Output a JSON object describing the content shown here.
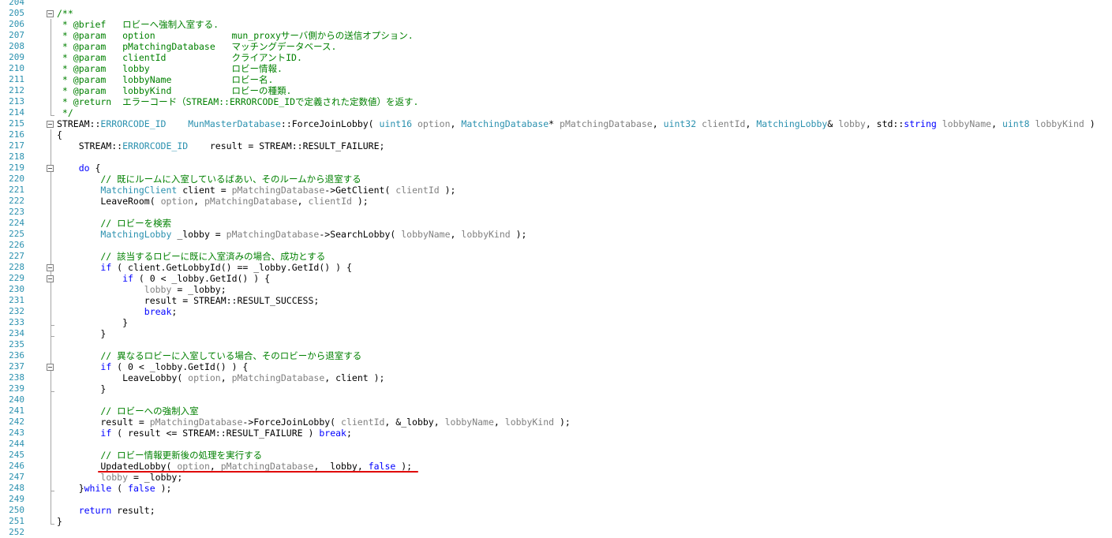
{
  "lines": [
    {
      "n": "204",
      "code": []
    },
    {
      "n": "205",
      "code": [
        {
          "t": "/**",
          "c": "c"
        }
      ]
    },
    {
      "n": "206",
      "code": [
        {
          "t": " * @brief   ロビーへ強制入室する.",
          "c": "c"
        }
      ]
    },
    {
      "n": "207",
      "code": [
        {
          "t": " * @param   option              mun_proxyサーバ側からの送信オプション.",
          "c": "c"
        }
      ]
    },
    {
      "n": "208",
      "code": [
        {
          "t": " * @param   pMatchingDatabase   マッチングデータベース.",
          "c": "c"
        }
      ]
    },
    {
      "n": "209",
      "code": [
        {
          "t": " * @param   clientId            クライアントID.",
          "c": "c"
        }
      ]
    },
    {
      "n": "210",
      "code": [
        {
          "t": " * @param   lobby               ロビー情報.",
          "c": "c"
        }
      ]
    },
    {
      "n": "211",
      "code": [
        {
          "t": " * @param   lobbyName           ロビー名.",
          "c": "c"
        }
      ]
    },
    {
      "n": "212",
      "code": [
        {
          "t": " * @param   lobbyKind           ロビーの種類.",
          "c": "c"
        }
      ]
    },
    {
      "n": "213",
      "code": [
        {
          "t": " * @return  エラーコード（STREAM::ERRORCODE_IDで定義された定数値）を返す.",
          "c": "c"
        }
      ]
    },
    {
      "n": "214",
      "code": [
        {
          "t": " */",
          "c": "c"
        }
      ]
    },
    {
      "n": "215",
      "code": [
        {
          "t": "STREAM::",
          "c": ""
        },
        {
          "t": "ERRORCODE_ID",
          "c": "t"
        },
        {
          "t": "    ",
          "c": ""
        },
        {
          "t": "MunMasterDatabase",
          "c": "t"
        },
        {
          "t": "::ForceJoinLobby( ",
          "c": ""
        },
        {
          "t": "uint16",
          "c": "t"
        },
        {
          "t": " option",
          "c": "p"
        },
        {
          "t": ", ",
          "c": ""
        },
        {
          "t": "MatchingDatabase",
          "c": "t"
        },
        {
          "t": "* ",
          "c": ""
        },
        {
          "t": "pMatchingDatabase",
          "c": "p"
        },
        {
          "t": ", ",
          "c": ""
        },
        {
          "t": "uint32",
          "c": "t"
        },
        {
          "t": " clientId",
          "c": "p"
        },
        {
          "t": ", ",
          "c": ""
        },
        {
          "t": "MatchingLobby",
          "c": "t"
        },
        {
          "t": "& ",
          "c": ""
        },
        {
          "t": "lobby",
          "c": "p"
        },
        {
          "t": ", std::",
          "c": ""
        },
        {
          "t": "string",
          "c": "k"
        },
        {
          "t": " lobbyName",
          "c": "p"
        },
        {
          "t": ", ",
          "c": ""
        },
        {
          "t": "uint8",
          "c": "t"
        },
        {
          "t": " lobbyKind",
          "c": "p"
        },
        {
          "t": " )",
          "c": ""
        }
      ]
    },
    {
      "n": "216",
      "code": [
        {
          "t": "{",
          "c": ""
        }
      ]
    },
    {
      "n": "217",
      "code": [
        {
          "t": "    STREAM::",
          "c": ""
        },
        {
          "t": "ERRORCODE_ID",
          "c": "t"
        },
        {
          "t": "    result = STREAM::RESULT_FAILURE;",
          "c": ""
        }
      ]
    },
    {
      "n": "218",
      "code": []
    },
    {
      "n": "219",
      "code": [
        {
          "t": "    ",
          "c": ""
        },
        {
          "t": "do",
          "c": "k"
        },
        {
          "t": " {",
          "c": ""
        }
      ]
    },
    {
      "n": "220",
      "code": [
        {
          "t": "        // 既にルームに入室しているばあい、そのルームから退室する",
          "c": "c"
        }
      ]
    },
    {
      "n": "221",
      "code": [
        {
          "t": "        ",
          "c": ""
        },
        {
          "t": "MatchingClient",
          "c": "t"
        },
        {
          "t": " client = ",
          "c": ""
        },
        {
          "t": "pMatchingDatabase",
          "c": "p"
        },
        {
          "t": "->GetClient( ",
          "c": ""
        },
        {
          "t": "clientId",
          "c": "p"
        },
        {
          "t": " );",
          "c": ""
        }
      ]
    },
    {
      "n": "222",
      "code": [
        {
          "t": "        LeaveRoom( ",
          "c": ""
        },
        {
          "t": "option",
          "c": "p"
        },
        {
          "t": ", ",
          "c": ""
        },
        {
          "t": "pMatchingDatabase",
          "c": "p"
        },
        {
          "t": ", ",
          "c": ""
        },
        {
          "t": "clientId",
          "c": "p"
        },
        {
          "t": " );",
          "c": ""
        }
      ]
    },
    {
      "n": "223",
      "code": []
    },
    {
      "n": "224",
      "code": [
        {
          "t": "        // ロビーを検索",
          "c": "c"
        }
      ]
    },
    {
      "n": "225",
      "code": [
        {
          "t": "        ",
          "c": ""
        },
        {
          "t": "MatchingLobby",
          "c": "t"
        },
        {
          "t": " _lobby = ",
          "c": ""
        },
        {
          "t": "pMatchingDatabase",
          "c": "p"
        },
        {
          "t": "->SearchLobby( ",
          "c": ""
        },
        {
          "t": "lobbyName",
          "c": "p"
        },
        {
          "t": ", ",
          "c": ""
        },
        {
          "t": "lobbyKind",
          "c": "p"
        },
        {
          "t": " );",
          "c": ""
        }
      ]
    },
    {
      "n": "226",
      "code": []
    },
    {
      "n": "227",
      "code": [
        {
          "t": "        // 該当するロビーに既に入室済みの場合、成功とする",
          "c": "c"
        }
      ]
    },
    {
      "n": "228",
      "code": [
        {
          "t": "        ",
          "c": ""
        },
        {
          "t": "if",
          "c": "k"
        },
        {
          "t": " ( client.GetLobbyId() == _lobby.GetId() ) {",
          "c": ""
        }
      ]
    },
    {
      "n": "229",
      "code": [
        {
          "t": "            ",
          "c": ""
        },
        {
          "t": "if",
          "c": "k"
        },
        {
          "t": " ( 0 < _lobby.GetId() ) {",
          "c": ""
        }
      ]
    },
    {
      "n": "230",
      "code": [
        {
          "t": "                ",
          "c": ""
        },
        {
          "t": "lobby",
          "c": "p"
        },
        {
          "t": " = _lobby;",
          "c": ""
        }
      ]
    },
    {
      "n": "231",
      "code": [
        {
          "t": "                result = STREAM::RESULT_SUCCESS;",
          "c": ""
        }
      ]
    },
    {
      "n": "232",
      "code": [
        {
          "t": "                ",
          "c": ""
        },
        {
          "t": "break",
          "c": "k"
        },
        {
          "t": ";",
          "c": ""
        }
      ]
    },
    {
      "n": "233",
      "code": [
        {
          "t": "            }",
          "c": ""
        }
      ]
    },
    {
      "n": "234",
      "code": [
        {
          "t": "        }",
          "c": ""
        }
      ]
    },
    {
      "n": "235",
      "code": []
    },
    {
      "n": "236",
      "code": [
        {
          "t": "        // 異なるロビーに入室している場合、そのロビーから退室する",
          "c": "c"
        }
      ]
    },
    {
      "n": "237",
      "code": [
        {
          "t": "        ",
          "c": ""
        },
        {
          "t": "if",
          "c": "k"
        },
        {
          "t": " ( 0 < _lobby.GetId() ) {",
          "c": ""
        }
      ]
    },
    {
      "n": "238",
      "code": [
        {
          "t": "            LeaveLobby( ",
          "c": ""
        },
        {
          "t": "option",
          "c": "p"
        },
        {
          "t": ", ",
          "c": ""
        },
        {
          "t": "pMatchingDatabase",
          "c": "p"
        },
        {
          "t": ", client );",
          "c": ""
        }
      ]
    },
    {
      "n": "239",
      "code": [
        {
          "t": "        }",
          "c": ""
        }
      ]
    },
    {
      "n": "240",
      "code": []
    },
    {
      "n": "241",
      "code": [
        {
          "t": "        // ロビーへの強制入室",
          "c": "c"
        }
      ]
    },
    {
      "n": "242",
      "code": [
        {
          "t": "        result = ",
          "c": ""
        },
        {
          "t": "pMatchingDatabase",
          "c": "p"
        },
        {
          "t": "->ForceJoinLobby( ",
          "c": ""
        },
        {
          "t": "clientId",
          "c": "p"
        },
        {
          "t": ", &_lobby, ",
          "c": ""
        },
        {
          "t": "lobbyName",
          "c": "p"
        },
        {
          "t": ", ",
          "c": ""
        },
        {
          "t": "lobbyKind",
          "c": "p"
        },
        {
          "t": " );",
          "c": ""
        }
      ]
    },
    {
      "n": "243",
      "code": [
        {
          "t": "        ",
          "c": ""
        },
        {
          "t": "if",
          "c": "k"
        },
        {
          "t": " ( result <= STREAM::RESULT_FAILURE ) ",
          "c": ""
        },
        {
          "t": "break",
          "c": "k"
        },
        {
          "t": ";",
          "c": ""
        }
      ]
    },
    {
      "n": "244",
      "code": []
    },
    {
      "n": "245",
      "code": [
        {
          "t": "        // ロビー情報更新後の処理を実行する",
          "c": "c"
        }
      ]
    },
    {
      "n": "246",
      "code": [
        {
          "t": "        UpdatedLobby( ",
          "c": ""
        },
        {
          "t": "option",
          "c": "p"
        },
        {
          "t": ", ",
          "c": ""
        },
        {
          "t": "pMatchingDatabase",
          "c": "p"
        },
        {
          "t": ", _lobby, ",
          "c": ""
        },
        {
          "t": "false",
          "c": "k"
        },
        {
          "t": " );",
          "c": ""
        }
      ]
    },
    {
      "n": "247",
      "code": [
        {
          "t": "        ",
          "c": ""
        },
        {
          "t": "lobby",
          "c": "p"
        },
        {
          "t": " = _lobby;",
          "c": ""
        }
      ]
    },
    {
      "n": "248",
      "code": [
        {
          "t": "    }",
          "c": ""
        },
        {
          "t": "while",
          "c": "k"
        },
        {
          "t": " ( ",
          "c": ""
        },
        {
          "t": "false",
          "c": "k"
        },
        {
          "t": " );",
          "c": ""
        }
      ]
    },
    {
      "n": "249",
      "code": []
    },
    {
      "n": "250",
      "code": [
        {
          "t": "    ",
          "c": ""
        },
        {
          "t": "return",
          "c": "k"
        },
        {
          "t": " result;",
          "c": ""
        }
      ]
    },
    {
      "n": "251",
      "code": [
        {
          "t": "}",
          "c": ""
        }
      ]
    },
    {
      "n": "252",
      "code": []
    }
  ],
  "colors": {
    "comment": "#008000",
    "keyword": "#0000ff",
    "type": "#2b91af",
    "parameter": "#808080",
    "line_number": "#2b91af",
    "highlight_underline": "#e00000"
  }
}
